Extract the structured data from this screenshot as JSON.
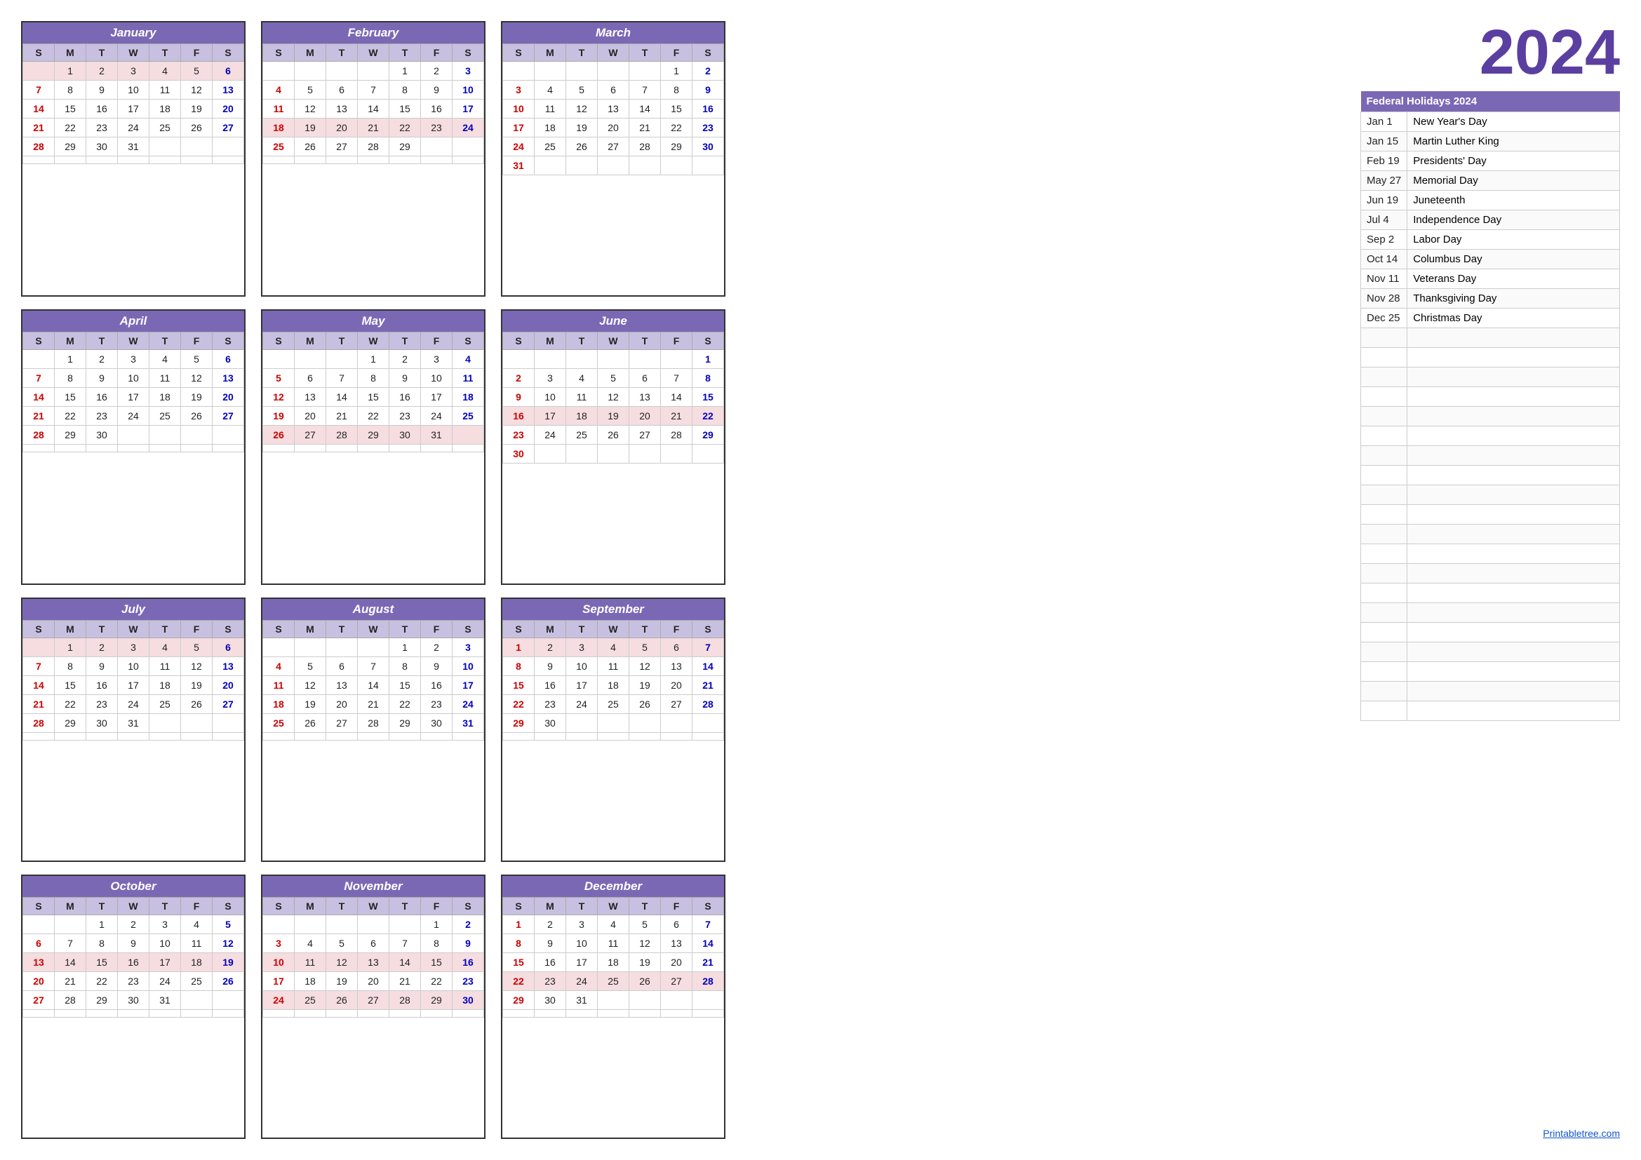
{
  "year": "2024",
  "footer_link": "Printabletree.com",
  "holidays_header": "Federal Holidays 2024",
  "holidays": [
    {
      "date": "Jan 1",
      "name": "New Year's Day"
    },
    {
      "date": "Jan 15",
      "name": "Martin Luther King"
    },
    {
      "date": "Feb 19",
      "name": "Presidents' Day"
    },
    {
      "date": "May 27",
      "name": "Memorial Day"
    },
    {
      "date": "Jun 19",
      "name": "Juneteenth"
    },
    {
      "date": "Jul 4",
      "name": "Independence Day"
    },
    {
      "date": "Sep 2",
      "name": "Labor Day"
    },
    {
      "date": "Oct 14",
      "name": "Columbus Day"
    },
    {
      "date": "Nov 11",
      "name": "Veterans Day"
    },
    {
      "date": "Nov 28",
      "name": "Thanksgiving Day"
    },
    {
      "date": "Dec 25",
      "name": "Christmas Day"
    }
  ],
  "months": [
    {
      "name": "January",
      "days": [
        [
          null,
          1,
          2,
          3,
          4,
          5,
          6
        ],
        [
          7,
          8,
          9,
          10,
          11,
          12,
          13
        ],
        [
          14,
          15,
          16,
          17,
          18,
          19,
          20
        ],
        [
          21,
          22,
          23,
          24,
          25,
          26,
          27
        ],
        [
          28,
          29,
          30,
          31,
          null,
          null,
          null
        ],
        [
          null,
          null,
          null,
          null,
          null,
          null,
          null
        ]
      ],
      "holiday_days": [
        1
      ],
      "holiday_rows": [
        0
      ]
    },
    {
      "name": "February",
      "days": [
        [
          null,
          null,
          null,
          null,
          1,
          2,
          3
        ],
        [
          4,
          5,
          6,
          7,
          8,
          9,
          10
        ],
        [
          11,
          12,
          13,
          14,
          15,
          16,
          17
        ],
        [
          18,
          19,
          20,
          21,
          22,
          23,
          24
        ],
        [
          25,
          26,
          27,
          28,
          29,
          null,
          null
        ],
        [
          null,
          null,
          null,
          null,
          null,
          null,
          null
        ]
      ],
      "holiday_days": [
        19
      ],
      "holiday_rows": [
        3
      ]
    },
    {
      "name": "March",
      "days": [
        [
          null,
          null,
          null,
          null,
          null,
          1,
          2
        ],
        [
          3,
          4,
          5,
          6,
          7,
          8,
          9
        ],
        [
          10,
          11,
          12,
          13,
          14,
          15,
          16
        ],
        [
          17,
          18,
          19,
          20,
          21,
          22,
          23
        ],
        [
          24,
          25,
          26,
          27,
          28,
          29,
          30
        ],
        [
          31,
          null,
          null,
          null,
          null,
          null,
          null
        ]
      ],
      "holiday_days": [],
      "holiday_rows": []
    },
    {
      "name": "April",
      "days": [
        [
          null,
          1,
          2,
          3,
          4,
          5,
          6
        ],
        [
          7,
          8,
          9,
          10,
          11,
          12,
          13
        ],
        [
          14,
          15,
          16,
          17,
          18,
          19,
          20
        ],
        [
          21,
          22,
          23,
          24,
          25,
          26,
          27
        ],
        [
          28,
          29,
          30,
          null,
          null,
          null,
          null
        ],
        [
          null,
          null,
          null,
          null,
          null,
          null,
          null
        ]
      ],
      "holiday_days": [],
      "holiday_rows": []
    },
    {
      "name": "May",
      "days": [
        [
          null,
          null,
          null,
          1,
          2,
          3,
          4
        ],
        [
          5,
          6,
          7,
          8,
          9,
          10,
          11
        ],
        [
          12,
          13,
          14,
          15,
          16,
          17,
          18
        ],
        [
          19,
          20,
          21,
          22,
          23,
          24,
          25
        ],
        [
          26,
          27,
          28,
          29,
          30,
          31,
          null
        ],
        [
          null,
          null,
          null,
          null,
          null,
          null,
          null
        ]
      ],
      "holiday_days": [
        27
      ],
      "holiday_rows": [
        4
      ]
    },
    {
      "name": "June",
      "days": [
        [
          null,
          null,
          null,
          null,
          null,
          null,
          1
        ],
        [
          2,
          3,
          4,
          5,
          6,
          7,
          8
        ],
        [
          9,
          10,
          11,
          12,
          13,
          14,
          15
        ],
        [
          16,
          17,
          18,
          19,
          20,
          21,
          22
        ],
        [
          23,
          24,
          25,
          26,
          27,
          28,
          29
        ],
        [
          30,
          null,
          null,
          null,
          null,
          null,
          null
        ]
      ],
      "holiday_days": [
        19
      ],
      "holiday_rows": [
        3
      ]
    },
    {
      "name": "July",
      "days": [
        [
          null,
          1,
          2,
          3,
          4,
          5,
          6
        ],
        [
          7,
          8,
          9,
          10,
          11,
          12,
          13
        ],
        [
          14,
          15,
          16,
          17,
          18,
          19,
          20
        ],
        [
          21,
          22,
          23,
          24,
          25,
          26,
          27
        ],
        [
          28,
          29,
          30,
          31,
          null,
          null,
          null
        ],
        [
          null,
          null,
          null,
          null,
          null,
          null,
          null
        ]
      ],
      "holiday_days": [
        4
      ],
      "holiday_rows": [
        0
      ]
    },
    {
      "name": "August",
      "days": [
        [
          null,
          null,
          null,
          null,
          1,
          2,
          3
        ],
        [
          4,
          5,
          6,
          7,
          8,
          9,
          10
        ],
        [
          11,
          12,
          13,
          14,
          15,
          16,
          17
        ],
        [
          18,
          19,
          20,
          21,
          22,
          23,
          24
        ],
        [
          25,
          26,
          27,
          28,
          29,
          30,
          31
        ],
        [
          null,
          null,
          null,
          null,
          null,
          null,
          null
        ]
      ],
      "holiday_days": [],
      "holiday_rows": []
    },
    {
      "name": "September",
      "days": [
        [
          1,
          2,
          3,
          4,
          5,
          6,
          7
        ],
        [
          8,
          9,
          10,
          11,
          12,
          13,
          14
        ],
        [
          15,
          16,
          17,
          18,
          19,
          20,
          21
        ],
        [
          22,
          23,
          24,
          25,
          26,
          27,
          28
        ],
        [
          29,
          30,
          null,
          null,
          null,
          null,
          null
        ],
        [
          null,
          null,
          null,
          null,
          null,
          null,
          null
        ]
      ],
      "holiday_days": [
        2
      ],
      "holiday_rows": [
        0
      ]
    },
    {
      "name": "October",
      "days": [
        [
          null,
          null,
          1,
          2,
          3,
          4,
          5
        ],
        [
          6,
          7,
          8,
          9,
          10,
          11,
          12
        ],
        [
          13,
          14,
          15,
          16,
          17,
          18,
          19
        ],
        [
          20,
          21,
          22,
          23,
          24,
          25,
          26
        ],
        [
          27,
          28,
          29,
          30,
          31,
          null,
          null
        ],
        [
          null,
          null,
          null,
          null,
          null,
          null,
          null
        ]
      ],
      "holiday_days": [
        14
      ],
      "holiday_rows": [
        2
      ]
    },
    {
      "name": "November",
      "days": [
        [
          null,
          null,
          null,
          null,
          null,
          1,
          2
        ],
        [
          3,
          4,
          5,
          6,
          7,
          8,
          9
        ],
        [
          10,
          11,
          12,
          13,
          14,
          15,
          16
        ],
        [
          17,
          18,
          19,
          20,
          21,
          22,
          23
        ],
        [
          24,
          25,
          26,
          27,
          28,
          29,
          30
        ],
        [
          null,
          null,
          null,
          null,
          null,
          null,
          null
        ]
      ],
      "holiday_days": [
        11,
        28
      ],
      "holiday_rows": [
        2,
        4
      ]
    },
    {
      "name": "December",
      "days": [
        [
          1,
          2,
          3,
          4,
          5,
          6,
          7
        ],
        [
          8,
          9,
          10,
          11,
          12,
          13,
          14
        ],
        [
          15,
          16,
          17,
          18,
          19,
          20,
          21
        ],
        [
          22,
          23,
          24,
          25,
          26,
          27,
          28
        ],
        [
          29,
          30,
          31,
          null,
          null,
          null,
          null
        ],
        [
          null,
          null,
          null,
          null,
          null,
          null,
          null
        ]
      ],
      "holiday_days": [
        25
      ],
      "holiday_rows": [
        3
      ]
    }
  ],
  "day_headers": [
    "S",
    "M",
    "T",
    "W",
    "T",
    "F",
    "S"
  ]
}
